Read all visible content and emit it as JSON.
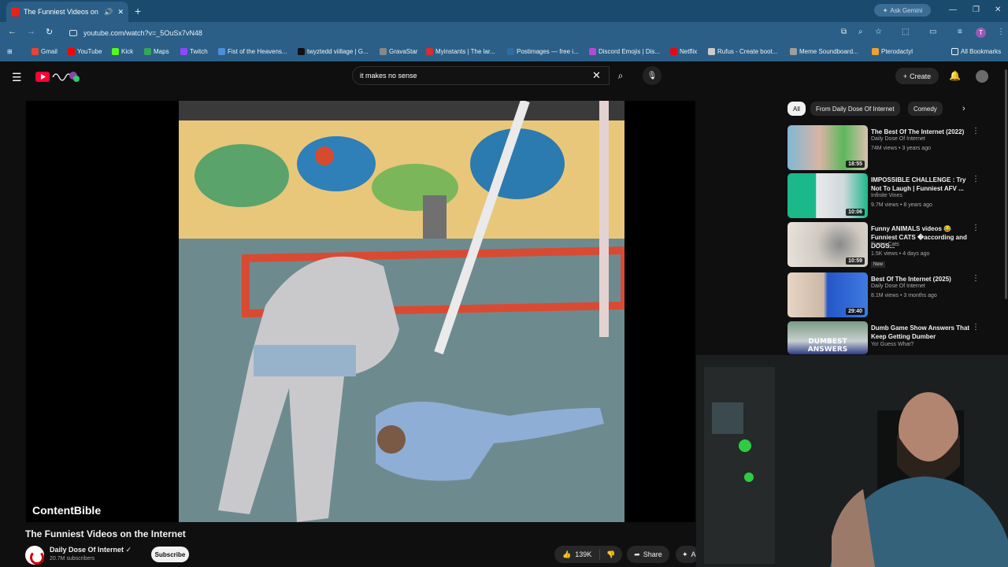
{
  "browser": {
    "tab_title": "The Funniest Videos on the",
    "url": "youtube.com/watch?v=_5OuSx7vN48",
    "gemini_label": "Ask Gemini",
    "bookmarks": [
      {
        "label": "Gmail",
        "color": "#ea4335"
      },
      {
        "label": "YouTube",
        "color": "#ff0000"
      },
      {
        "label": "Kick",
        "color": "#53fc18"
      },
      {
        "label": "Maps",
        "color": "#34a853"
      },
      {
        "label": "Twitch",
        "color": "#9146ff"
      },
      {
        "label": "Fist of the Heavens...",
        "color": "#4a90d9"
      },
      {
        "label": "twyztedd viillage | G...",
        "color": "#111111"
      },
      {
        "label": "GravaStar",
        "color": "#888888"
      },
      {
        "label": "Myinstants | The lar...",
        "color": "#d32f2f"
      },
      {
        "label": "Postimages — free i...",
        "color": "#2e6da4"
      },
      {
        "label": "Discord Emojis | Dis...",
        "color": "#b44ad6"
      },
      {
        "label": "Netflix",
        "color": "#e50914"
      },
      {
        "label": "Rufus - Create boot...",
        "color": "#cccccc"
      },
      {
        "label": "Meme Soundboard...",
        "color": "#9e9e9e"
      },
      {
        "label": "Pterodactyl",
        "color": "#f0a030"
      }
    ],
    "all_bookmarks": "All Bookmarks"
  },
  "youtube": {
    "search_query": "it makes no sense",
    "create_label": "Create",
    "video": {
      "watermark": "ContentBible",
      "title": "The Funniest Videos on the Internet",
      "channel": "Daily Dose Of Internet",
      "subscribers": "20.7M subscribers",
      "subscribe_label": "Subscribe",
      "likes": "139K",
      "share_label": "Share",
      "more_label": "A"
    },
    "chips": [
      "All",
      "From Daily Dose Of Internet",
      "Comedy"
    ],
    "related": [
      {
        "title": "The Best Of The Internet (2022)",
        "channel": "Daily Dose Of Internet",
        "meta": "74M views • 3 years ago",
        "duration": "18:55"
      },
      {
        "title": "IMPOSSIBLE CHALLENGE : Try Not To Laugh | Funniest AFV ...",
        "channel": "Infinite Vines",
        "meta": "9.7M views • 8 years ago",
        "duration": "10:06"
      },
      {
        "title": "Funny ANIMALS videos 😂 Funniest CATS �according and DOGS...",
        "channel": "Funny Cats",
        "meta": "1.5K views • 4 days ago",
        "duration": "10:59",
        "badge": "New"
      },
      {
        "title": "Best Of The Internet (2025)",
        "channel": "Daily Dose Of Internet",
        "meta": "8.1M views • 3 months ago",
        "duration": "29:40"
      },
      {
        "title": "Dumb Game Show Answers That Keep Getting Dumber",
        "channel": "Yo! Guess What?",
        "meta": "",
        "duration": "",
        "thumb_text": "DUMBEST ANSWERS"
      }
    ]
  }
}
